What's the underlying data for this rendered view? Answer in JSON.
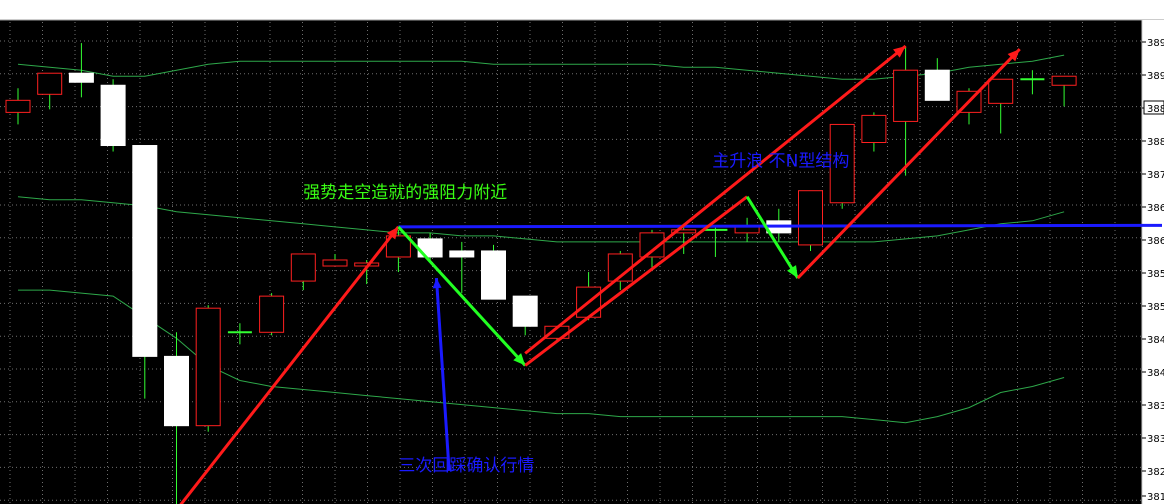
{
  "chart_data": {
    "type": "candlestick",
    "ylim": [
      3815,
      3895
    ],
    "grid": true,
    "colors": {
      "background": "#000000",
      "grid": "#6f6f6f",
      "bull_body": "#000000",
      "bull_border": "#ff2020",
      "bear_body": "#ffffff",
      "bear_border": "#ffffff",
      "doji": "#33ff33",
      "wick": "#33ff33",
      "bollinger": "#2ea84a",
      "resistance": "#1a1aff",
      "trend_up": "#ff1a1a",
      "pullback": "#22ff22",
      "text_green": "#39ff14",
      "text_blue": "#1a1aff"
    },
    "y_ticks": [
      "389",
      "389",
      "388",
      "388",
      "387",
      "386",
      "386",
      "385",
      "385",
      "384",
      "384",
      "383",
      "383",
      "382",
      "381"
    ],
    "current_price_tick": "388",
    "candles": [
      {
        "o": 3880.0,
        "h": 3884.0,
        "l": 3878.0,
        "c": 3882.0
      },
      {
        "o": 3883.0,
        "h": 3886.5,
        "l": 3880.5,
        "c": 3886.5
      },
      {
        "o": 3886.5,
        "h": 3891.5,
        "l": 3882.5,
        "c": 3885.0
      },
      {
        "o": 3884.5,
        "h": 3885.5,
        "l": 3873.5,
        "c": 3874.5
      },
      {
        "o": 3874.5,
        "h": 3874.5,
        "l": 3832.5,
        "c": 3839.5
      },
      {
        "o": 3839.5,
        "h": 3843.5,
        "l": 3814.5,
        "c": 3828.0
      },
      {
        "o": 3828.0,
        "h": 3848.0,
        "l": 3827.0,
        "c": 3847.5
      },
      {
        "o": 3843.5,
        "h": 3845.0,
        "l": 3841.5,
        "c": 3843.5
      },
      {
        "o": 3843.5,
        "h": 3850.0,
        "l": 3843.0,
        "c": 3849.5
      },
      {
        "o": 3852.0,
        "h": 3856.0,
        "l": 3850.5,
        "c": 3856.5
      },
      {
        "o": 3854.5,
        "h": 3856.5,
        "l": 3854.5,
        "c": 3855.5
      },
      {
        "o": 3854.5,
        "h": 3855.5,
        "l": 3851.5,
        "c": 3855.0
      },
      {
        "o": 3856.0,
        "h": 3860.5,
        "l": 3853.5,
        "c": 3859.5
      },
      {
        "o": 3859.0,
        "h": 3860.0,
        "l": 3855.0,
        "c": 3856.0
      },
      {
        "o": 3857.0,
        "h": 3858.5,
        "l": 3850.0,
        "c": 3856.0
      },
      {
        "o": 3857.0,
        "h": 3858.0,
        "l": 3849.0,
        "c": 3849.0
      },
      {
        "o": 3849.5,
        "h": 3847.5,
        "l": 3843.0,
        "c": 3844.5
      },
      {
        "o": 3842.5,
        "h": 3844.5,
        "l": 3842.0,
        "c": 3844.5
      },
      {
        "o": 3846.0,
        "h": 3853.5,
        "l": 3845.5,
        "c": 3851.0
      },
      {
        "o": 3852.0,
        "h": 3857.0,
        "l": 3850.5,
        "c": 3856.5
      },
      {
        "o": 3856.0,
        "h": 3860.5,
        "l": 3854.0,
        "c": 3860.0
      },
      {
        "o": 3860.0,
        "h": 3861.5,
        "l": 3856.5,
        "c": 3860.5
      },
      {
        "o": 3860.5,
        "h": 3861.0,
        "l": 3856.0,
        "c": 3860.5
      },
      {
        "o": 3860.0,
        "h": 3862.5,
        "l": 3858.5,
        "c": 3861.0
      },
      {
        "o": 3862.0,
        "h": 3864.0,
        "l": 3858.5,
        "c": 3860.0
      },
      {
        "o": 3858.0,
        "h": 3866.0,
        "l": 3857.0,
        "c": 3867.0
      },
      {
        "o": 3865.0,
        "h": 3876.0,
        "l": 3864.0,
        "c": 3878.0
      },
      {
        "o": 3875.0,
        "h": 3880.0,
        "l": 3873.5,
        "c": 3879.5
      },
      {
        "o": 3878.5,
        "h": 3891.0,
        "l": 3869.5,
        "c": 3887.0
      },
      {
        "o": 3887.0,
        "h": 3889.0,
        "l": 3882.0,
        "c": 3882.0
      },
      {
        "o": 3880.0,
        "h": 3884.0,
        "l": 3878.0,
        "c": 3883.5
      },
      {
        "o": 3881.5,
        "h": 3883.0,
        "l": 3876.5,
        "c": 3885.5
      },
      {
        "o": 3885.5,
        "h": 3887.0,
        "l": 3883.0,
        "c": 3885.5
      },
      {
        "o": 3884.5,
        "h": 3886.0,
        "l": 3881.0,
        "c": 3886.0
      }
    ],
    "bollinger": {
      "upper": [
        3888.0,
        3887.5,
        3887.0,
        3886.0,
        3886.0,
        3887.0,
        3888.0,
        3888.5,
        3888.5,
        3888.5,
        3888.5,
        3888.5,
        3888.5,
        3888.5,
        3888.5,
        3888.0,
        3888.0,
        3888.0,
        3888.0,
        3888.0,
        3888.0,
        3887.5,
        3887.5,
        3887.0,
        3886.5,
        3886.0,
        3885.5,
        3885.5,
        3886.0,
        3886.5,
        3887.5,
        3888.0,
        3888.5,
        3889.5
      ],
      "middle": [
        3866.0,
        3865.5,
        3865.5,
        3865.0,
        3864.5,
        3863.5,
        3863.0,
        3862.5,
        3862.0,
        3861.5,
        3861.0,
        3860.5,
        3860.0,
        3860.0,
        3859.5,
        3859.5,
        3859.0,
        3858.5,
        3858.5,
        3858.5,
        3858.5,
        3858.5,
        3858.5,
        3858.5,
        3858.5,
        3858.5,
        3858.5,
        3858.5,
        3859.0,
        3859.5,
        3860.5,
        3861.5,
        3862.0,
        3863.5
      ],
      "lower": [
        3850.5,
        3850.5,
        3850.0,
        3849.5,
        3846.0,
        3842.5,
        3838.0,
        3835.5,
        3834.5,
        3834.0,
        3833.5,
        3833.0,
        3832.5,
        3832.0,
        3831.5,
        3831.0,
        3830.5,
        3830.0,
        3830.0,
        3829.5,
        3829.5,
        3829.5,
        3829.5,
        3829.5,
        3829.5,
        3829.5,
        3829.5,
        3829.0,
        3828.5,
        3829.5,
        3831.0,
        3833.5,
        3834.5,
        3836.0
      ]
    },
    "resistance_level": 3861.0,
    "trend_segments": [
      {
        "kind": "up",
        "from": [
          5,
          3814.0
        ],
        "to": [
          12,
          3861.0
        ],
        "arrow": true
      },
      {
        "kind": "pullback",
        "from": [
          12,
          3861.0
        ],
        "to": [
          16,
          3838.0
        ],
        "arrow": true
      },
      {
        "kind": "up",
        "from": [
          16,
          3838.0
        ],
        "to": [
          23,
          3866.0
        ],
        "arrow": false
      },
      {
        "kind": "up",
        "from": [
          16,
          3840.0
        ],
        "to": [
          28,
          3891.0
        ],
        "arrow": true
      },
      {
        "kind": "pullback",
        "from": [
          23,
          3866.0
        ],
        "to": [
          24.6,
          3852.5
        ],
        "arrow": true
      },
      {
        "kind": "up",
        "from": [
          24.6,
          3852.5
        ],
        "to": [
          31.6,
          3890.5
        ],
        "arrow": true
      }
    ],
    "annotations": [
      {
        "text": "强势走空造就的强阻力附近",
        "color": "text_green",
        "x": 9,
        "y": 3865.8
      },
      {
        "text": "三次回踩确认行情",
        "color": "text_blue",
        "x": 12,
        "y": 3820.5
      },
      {
        "text": "主升浪 不N型结构",
        "color": "text_blue",
        "x": 21.9,
        "y": 3871.0
      }
    ],
    "callout_arrows": [
      {
        "from": [
          13.6,
          3820.5
        ],
        "to": [
          13.2,
          3852.5
        ],
        "color": "text_blue"
      }
    ]
  }
}
